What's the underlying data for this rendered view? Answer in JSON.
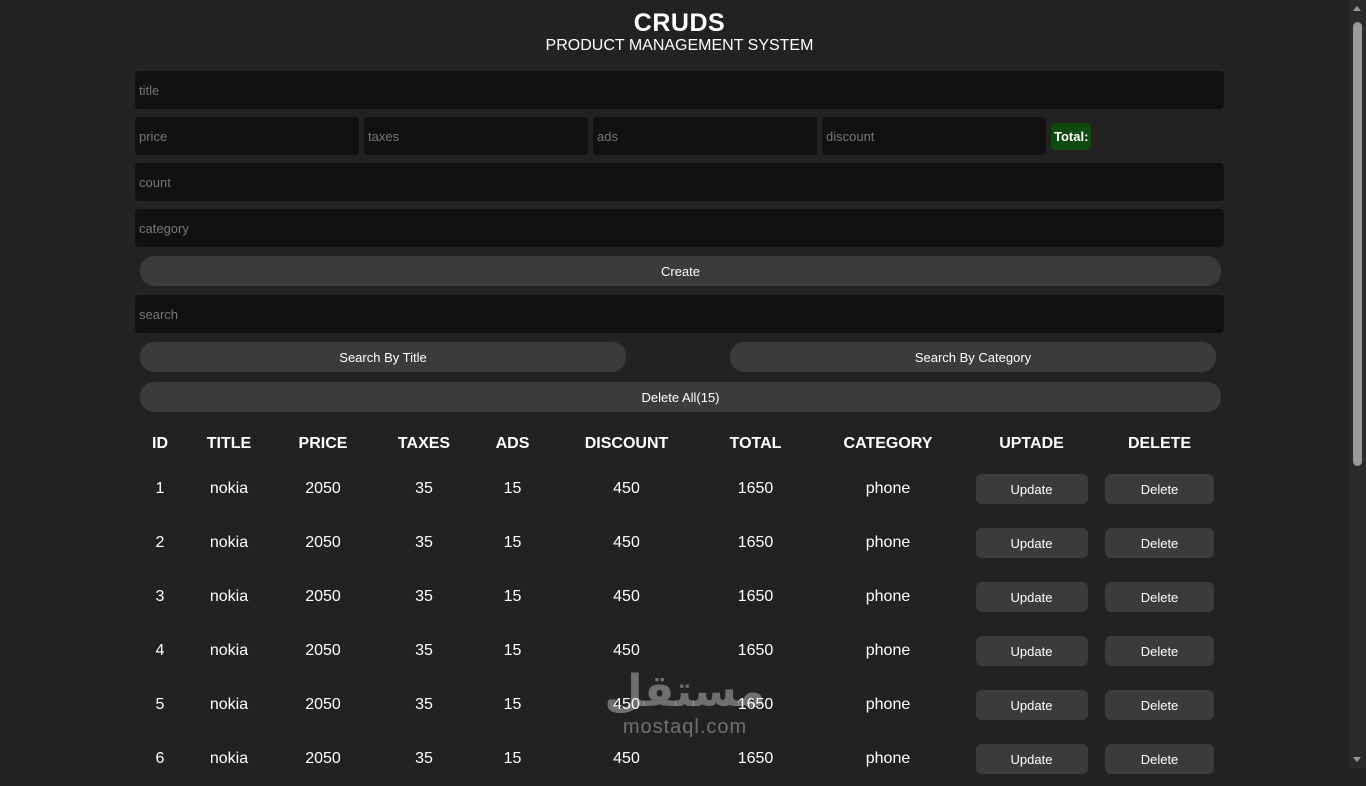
{
  "header": {
    "title": "CRUDS",
    "subtitle": "PRODUCT MANAGEMENT SYSTEM"
  },
  "form": {
    "title_placeholder": "title",
    "price_placeholder": "price",
    "taxes_placeholder": "taxes",
    "ads_placeholder": "ads",
    "discount_placeholder": "discount",
    "total_label": "Total:",
    "count_placeholder": "count",
    "category_placeholder": "category",
    "create_label": "Create"
  },
  "search": {
    "placeholder": "search",
    "by_title_label": "Search By Title",
    "by_category_label": "Search By Category",
    "delete_all_label": "Delete All(15)"
  },
  "table": {
    "headers": [
      "ID",
      "TITLE",
      "PRICE",
      "TAXES",
      "ADS",
      "DISCOUNT",
      "TOTAL",
      "CATEGORY",
      "UPTADE",
      "DELETE"
    ],
    "update_label": "Update",
    "delete_label": "Delete",
    "rows": [
      {
        "id": "1",
        "title": "nokia",
        "price": "2050",
        "taxes": "35",
        "ads": "15",
        "discount": "450",
        "total": "1650",
        "category": "phone"
      },
      {
        "id": "2",
        "title": "nokia",
        "price": "2050",
        "taxes": "35",
        "ads": "15",
        "discount": "450",
        "total": "1650",
        "category": "phone"
      },
      {
        "id": "3",
        "title": "nokia",
        "price": "2050",
        "taxes": "35",
        "ads": "15",
        "discount": "450",
        "total": "1650",
        "category": "phone"
      },
      {
        "id": "4",
        "title": "nokia",
        "price": "2050",
        "taxes": "35",
        "ads": "15",
        "discount": "450",
        "total": "1650",
        "category": "phone"
      },
      {
        "id": "5",
        "title": "nokia",
        "price": "2050",
        "taxes": "35",
        "ads": "15",
        "discount": "450",
        "total": "1650",
        "category": "phone"
      },
      {
        "id": "6",
        "title": "nokia",
        "price": "2050",
        "taxes": "35",
        "ads": "15",
        "discount": "450",
        "total": "1650",
        "category": "phone"
      }
    ]
  },
  "watermark": {
    "arabic": "مستقل",
    "latin": "mostaql.com"
  },
  "colors": {
    "background": "#222222",
    "input_bg": "#111111",
    "button_bg": "#3b3b3b",
    "total_bg": "#0e4a0e",
    "text": "#ffffff"
  }
}
